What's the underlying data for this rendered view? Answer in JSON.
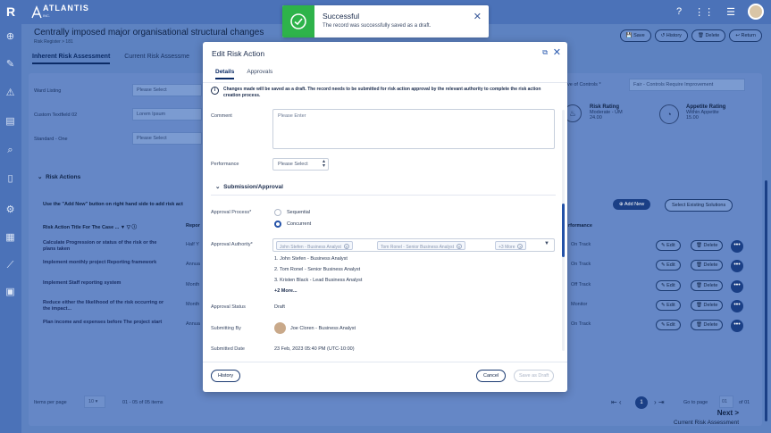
{
  "topbar": {
    "brand_letter": "R",
    "logo_text": "ATLANTIS",
    "logo_sub": "INC."
  },
  "page": {
    "title": "Centrally imposed major organisational structural changes",
    "breadcrumb": "Risk Register > 181",
    "buttons": {
      "save": "Save",
      "history": "History",
      "delete": "Delete",
      "return": "Return"
    },
    "tabs": [
      "Inherent Risk Assessment",
      "Current Risk Assessme"
    ]
  },
  "form_bg": {
    "ward_listing": {
      "label": "Ward Listing",
      "placeholder": "Please Select"
    },
    "custom_textfield": {
      "label": "Custom Textfield 02",
      "value": "Lorem Ipsum"
    },
    "standard_one": {
      "label": "Standard - One",
      "placeholder": "Please Select"
    },
    "controls_label": "ve of Controls *",
    "controls_value": "Fair - Controls Require Improvement",
    "risk_rating": {
      "label": "Risk Rating",
      "value": "Moderate - UM",
      "number": "24.00"
    },
    "appetite_rating": {
      "label": "Appetite Rating",
      "value": "Within Appetite",
      "number": "15.00"
    }
  },
  "risk_actions": {
    "heading": "Risk Actions",
    "hint": "Use the \"Add New\" button on right hand side to add risk act",
    "add_new": "Add New",
    "select_existing": "Select Existing Solutions",
    "col_title": "Risk Action Title For The Case ...",
    "col_report": "Repor",
    "col_performance": "rformance",
    "edit": "Edit",
    "delete": "Delete",
    "rows": [
      {
        "title": "Calculate Progression or status of the risk or the plans taken",
        "freq": "Half Y",
        "performance": "On Track"
      },
      {
        "title": "Implement monthly project Reporting framework",
        "freq": "Annua",
        "performance": "On Track"
      },
      {
        "title": "Implement Staff reporting system",
        "freq": "Month",
        "performance": "Off Track"
      },
      {
        "title": "Reduce either the likelihood of the risk occurring or the impact...",
        "freq": "Month",
        "performance": "Monitor"
      },
      {
        "title": "Plan income and expenses before The project start",
        "freq": "Annua",
        "performance": "On Track"
      }
    ]
  },
  "pagination": {
    "items_per_page_label": "Items per page",
    "items_per_page": "10",
    "range": "01 - 05 of 05 items",
    "current_page": "1",
    "goto_label": "Go to page",
    "goto_value": "01",
    "of_label": "of 01"
  },
  "next": {
    "label": "Next >",
    "sub": "Current Risk Assessment"
  },
  "toast": {
    "title": "Successful",
    "message": "The record was successfully saved as a draft."
  },
  "modal": {
    "title": "Edit Risk Action",
    "tabs": [
      "Details",
      "Approvals"
    ],
    "info": "Changes made will be saved as a draft. The record needs to be submitted for risk action approval by the relevant authority to complete the risk action creation process.",
    "comment_label": "Comment",
    "comment_placeholder": "Please Enter",
    "performance_label": "Performance",
    "performance_placeholder": "Please Select",
    "section": "Submission/Approval",
    "approval_process_label": "Approval Process*",
    "approval_options": [
      "Sequential",
      "Concurrent"
    ],
    "approval_selected": "Concurrent",
    "approval_authority_label": "Approval Authority*",
    "chips": [
      "John Stefen - Business Analyst",
      "Tom Ronel - Senior Business Analyst",
      "+3 More"
    ],
    "people": [
      "1. John Stefen - Business Analyst",
      "2. Tom Ronel - Senior Business Analyst",
      "3. Kristen Black - Lead Business Analyst"
    ],
    "more": "+2 More...",
    "approval_status_label": "Approval Status",
    "approval_status": "Draft",
    "submitted_by_label": "Submitting By",
    "submitted_by": "Joe Cloren - Business Analyst",
    "submitted_date_label": "Submitted Date",
    "submitted_date": "23 Feb, 2023 05:40 PM (UTC-10:00)",
    "history_btn": "History",
    "cancel_btn": "Cancel",
    "save_draft_btn": "Save as Draft"
  },
  "colors": {
    "accent": "#2452a8",
    "success": "#2eb34a",
    "overlay": "#5b7fbf"
  }
}
